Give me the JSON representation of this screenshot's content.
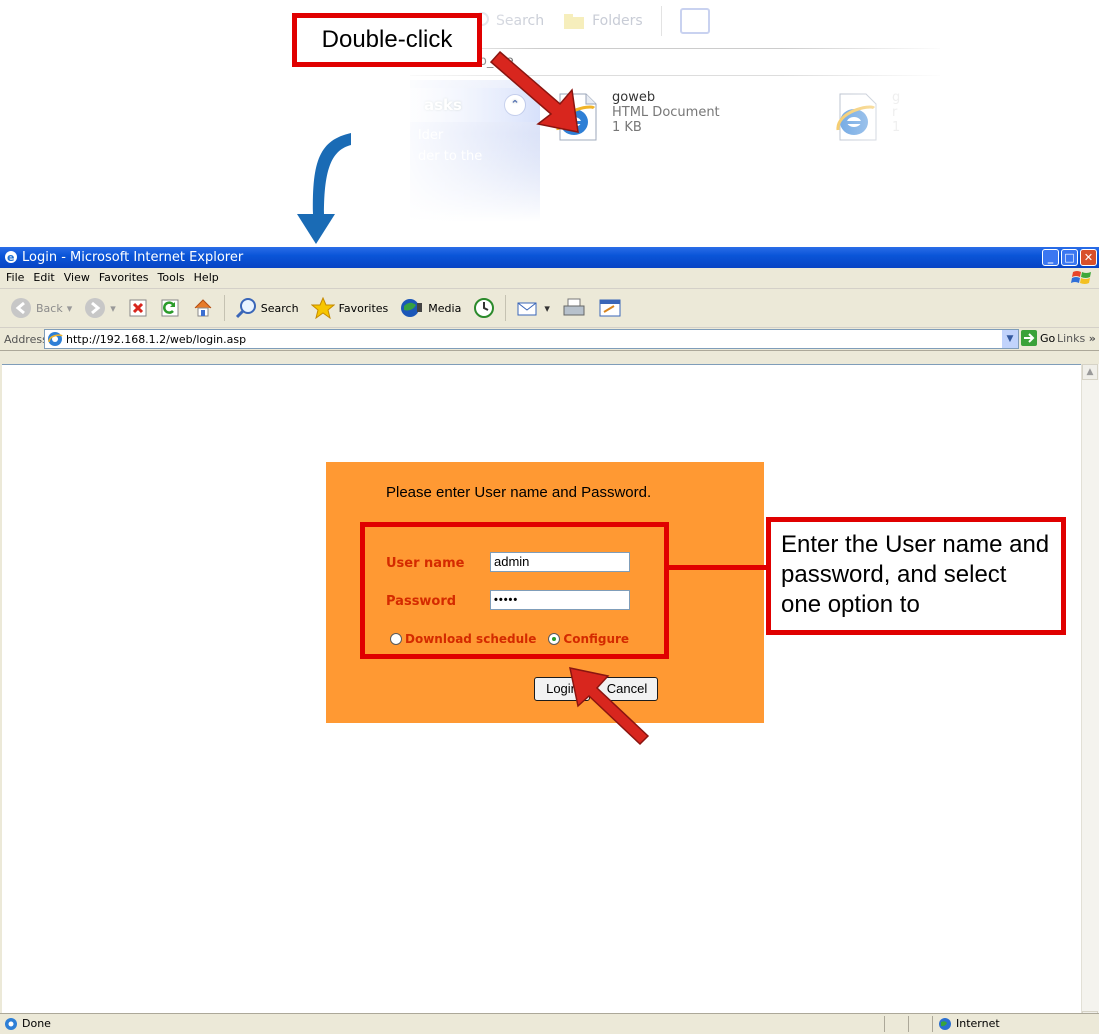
{
  "callouts": {
    "double_click": "Double-click",
    "login_instructions": "Enter the User name and password, and select one option to"
  },
  "explorer": {
    "toolbar": {
      "search": "Search",
      "folders": "Folders"
    },
    "address_fragment": "...TER\\web_...e",
    "tasks_header": "asks",
    "task_items": [
      "lder",
      "der to the"
    ],
    "file": {
      "name": "goweb",
      "type": "HTML Document",
      "size": "1 KB"
    },
    "file2_partial": [
      "g",
      "r",
      "1"
    ]
  },
  "window": {
    "title": "Login - Microsoft Internet Explorer",
    "menu": [
      "File",
      "Edit",
      "View",
      "Favorites",
      "Tools",
      "Help"
    ],
    "toolbar": {
      "back": "Back",
      "search": "Search",
      "favorites": "Favorites",
      "media": "Media"
    },
    "address": {
      "label": "Address",
      "url": "http://192.168.1.2/web/login.asp",
      "go": "Go",
      "links": "Links"
    },
    "status": {
      "left": "Done",
      "zone": "Internet"
    }
  },
  "login": {
    "prompt": "Please enter User name and Password.",
    "username_label": "User name",
    "username_value": "admin",
    "password_label": "Password",
    "password_value": "•••••",
    "radio_download": "Download schedule",
    "radio_configure": "Configure",
    "login_button": "Login",
    "cancel_button": "Cancel"
  },
  "colors": {
    "login_panel": "#ff9933",
    "callout_red": "#e00000",
    "arrow_blue": "#1a6bb5",
    "label_red": "#d42a00"
  }
}
